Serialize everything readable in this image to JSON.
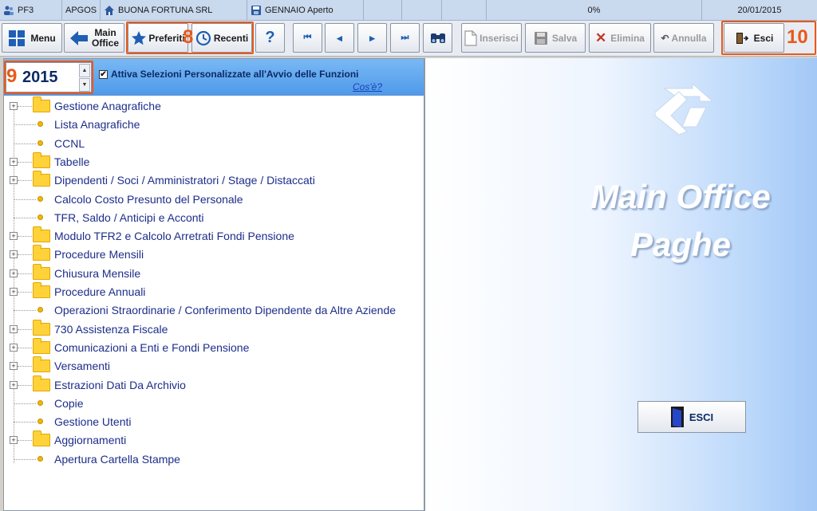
{
  "status_bar": {
    "user": "PF3",
    "app": "APGOS",
    "company": "BUONA FORTUNA SRL",
    "period": "GENNAIO Aperto",
    "progress": "0%",
    "date": "20/01/2015"
  },
  "toolbar": {
    "menu": "Menu",
    "main_office_line1": "Main",
    "main_office_line2": "Office",
    "preferiti": "Preferiti",
    "recenti": "Recenti",
    "help": "?",
    "first": "⏮",
    "prev": "◂",
    "next": "▸",
    "last": "⏭",
    "inserisci": "Inserisci",
    "salva": "Salva",
    "elimina": "Elimina",
    "annulla": "Annulla",
    "esci": "Esci"
  },
  "callouts": {
    "c8": "8",
    "c9": "9",
    "c10": "10"
  },
  "year_bar": {
    "year": "2015",
    "checkbox_label": "Attiva Selezioni Personalizzate all'Avvio delle Funzioni",
    "checked": true,
    "info_link": "Cos'è?"
  },
  "tree": [
    {
      "label": "Gestione Anagrafiche",
      "type": "folder"
    },
    {
      "label": "Lista Anagrafiche",
      "type": "leaf"
    },
    {
      "label": "CCNL",
      "type": "leaf"
    },
    {
      "label": "Tabelle",
      "type": "folder"
    },
    {
      "label": "Dipendenti / Soci / Amministratori / Stage  / Distaccati",
      "type": "folder"
    },
    {
      "label": "Calcolo Costo Presunto del Personale",
      "type": "leaf"
    },
    {
      "label": "TFR, Saldo / Anticipi e Acconti",
      "type": "leaf"
    },
    {
      "label": "Modulo TFR2 e Calcolo Arretrati Fondi Pensione",
      "type": "folder"
    },
    {
      "label": "Procedure Mensili",
      "type": "folder"
    },
    {
      "label": "Chiusura Mensile",
      "type": "folder"
    },
    {
      "label": "Procedure Annuali",
      "type": "folder"
    },
    {
      "label": "Operazioni Straordinarie / Conferimento Dipendente da Altre Aziende",
      "type": "leaf"
    },
    {
      "label": "730 Assistenza Fiscale",
      "type": "folder"
    },
    {
      "label": "Comunicazioni a Enti e Fondi Pensione",
      "type": "folder"
    },
    {
      "label": "Versamenti",
      "type": "folder"
    },
    {
      "label": "Estrazioni Dati Da  Archivio",
      "type": "folder"
    },
    {
      "label": "Copie",
      "type": "leaf"
    },
    {
      "label": "Gestione Utenti",
      "type": "leaf"
    },
    {
      "label": "Aggiornamenti",
      "type": "folder"
    },
    {
      "label": "Apertura Cartella Stampe",
      "type": "leaf"
    }
  ],
  "brand": {
    "line1": "Main Office",
    "line2": "Paghe",
    "exit_button": "ESCI"
  },
  "colors": {
    "accent": "#e8591a",
    "header_blue": "#4f9aea",
    "link": "#1d2d8a"
  }
}
